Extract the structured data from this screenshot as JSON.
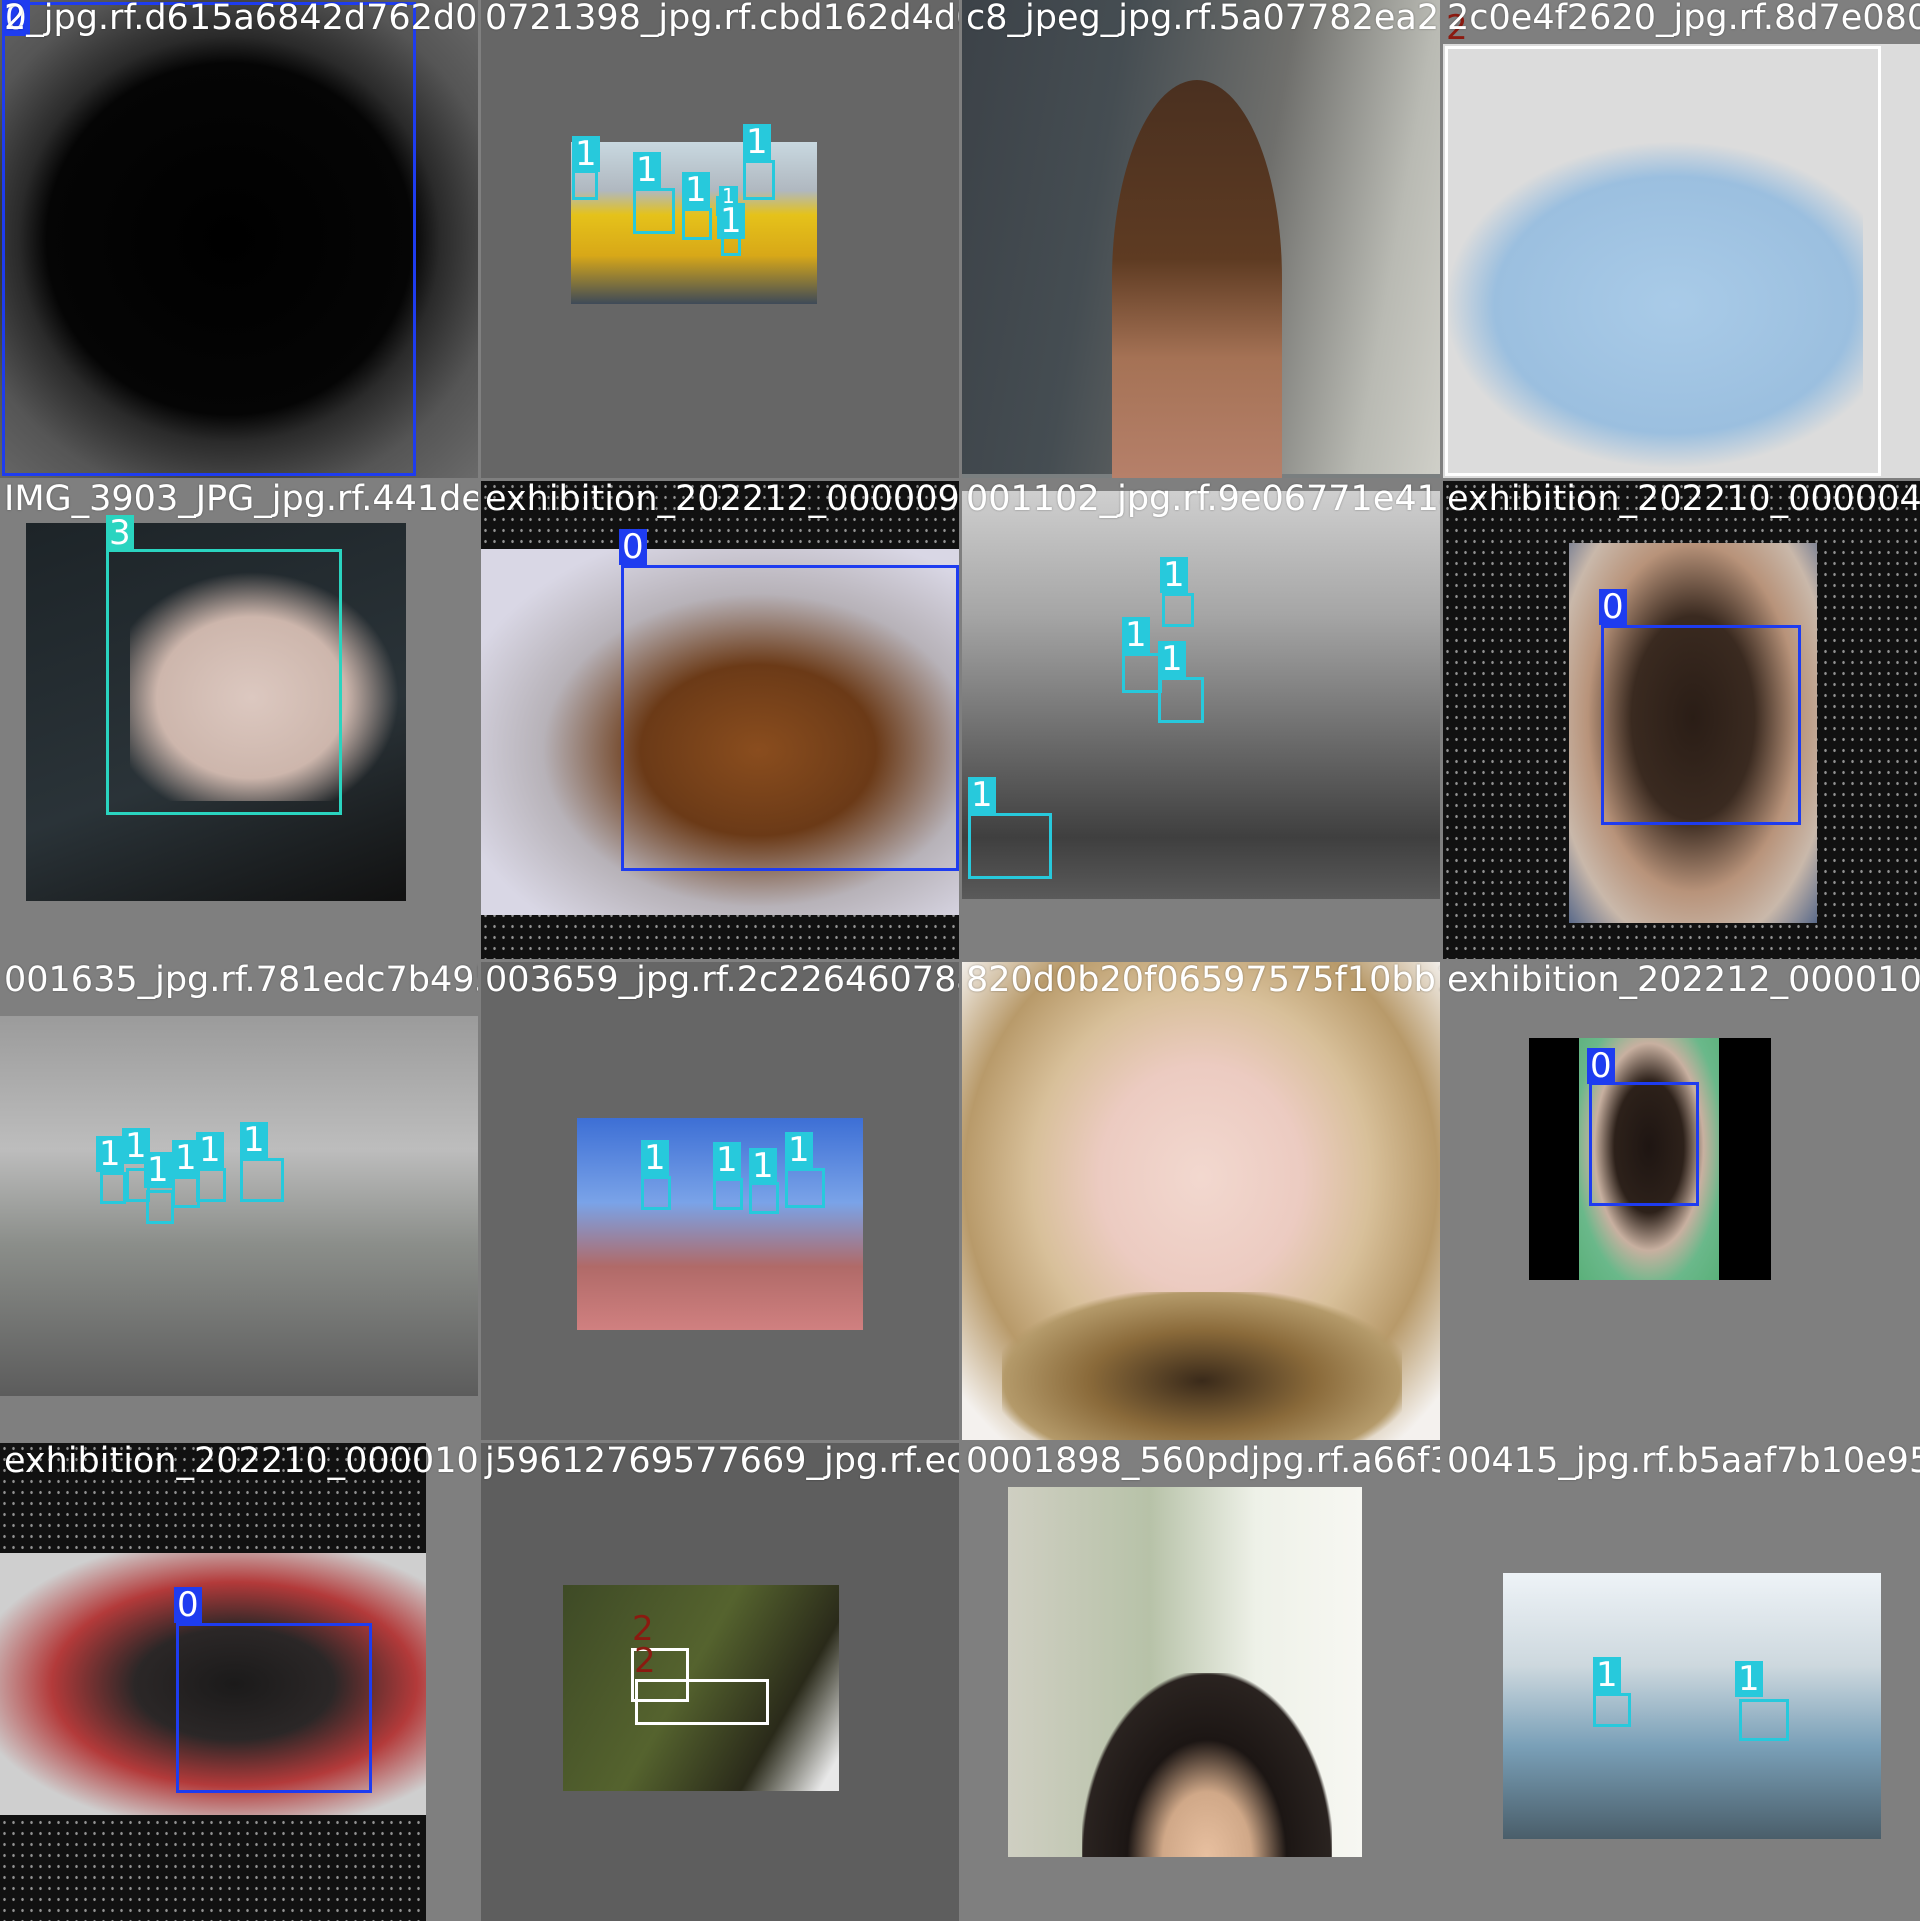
{
  "class_colors": {
    "0": "#1e3cf0",
    "1": "#27c9dc",
    "2": "#ffffff",
    "3": "#2ad4c0"
  },
  "tiles": [
    {
      "filename": "2_jpg.rf.d615a6842d762d0c9f026f3f82abf0fcbd162d4d094fb37",
      "labels": [
        "0"
      ]
    },
    {
      "filename": "0721398_jpg.rf.cbd162d4d094fb37ad8933e3ff5",
      "labels": [
        "1",
        "1",
        "1",
        "1",
        "1",
        "1"
      ]
    },
    {
      "filename": "c8_jpeg_jpg.rf.5a07782ea2d4f3346f362",
      "labels": []
    },
    {
      "filename": "2c0e4f2620_jpg.rf.8d7e0806",
      "labels": [
        "2"
      ]
    },
    {
      "filename": "IMG_3903_JPG_jpg.rf.441de386bcfb0d28f12",
      "labels": [
        "3"
      ]
    },
    {
      "filename": "exhibition_202212_0000099",
      "labels": [
        "0"
      ]
    },
    {
      "filename": "001102_jpg.rf.9e06771e41483416e965206",
      "labels": [
        "1",
        "1",
        "1",
        "1"
      ]
    },
    {
      "filename": "exhibition_202210_0000048",
      "labels": [
        "0"
      ]
    },
    {
      "filename": "001635_jpg.rf.781edc7b495e4f2699eaf742c",
      "labels": [
        "1",
        "1",
        "1",
        "1",
        "1",
        "1"
      ]
    },
    {
      "filename": "003659_jpg.rf.2c22646078a88",
      "labels": [
        "1",
        "1",
        "1",
        "1"
      ]
    },
    {
      "filename": "820d0b20f06597575f10bb1ed",
      "labels": []
    },
    {
      "filename": "exhibition_202212_0000103",
      "labels": [
        "0"
      ]
    },
    {
      "filename": "exhibition_202210_0000108",
      "labels": [
        "0"
      ]
    },
    {
      "filename": "j59612769577669_jpg.rf.ec15d0e892",
      "labels": [
        "2",
        "2"
      ]
    },
    {
      "filename": "0001898_560pdjpg.rf.a66f31240218809",
      "labels": []
    },
    {
      "filename": "00415_jpg.rf.b5aaf7b10e95b",
      "labels": [
        "1",
        "1"
      ]
    }
  ]
}
